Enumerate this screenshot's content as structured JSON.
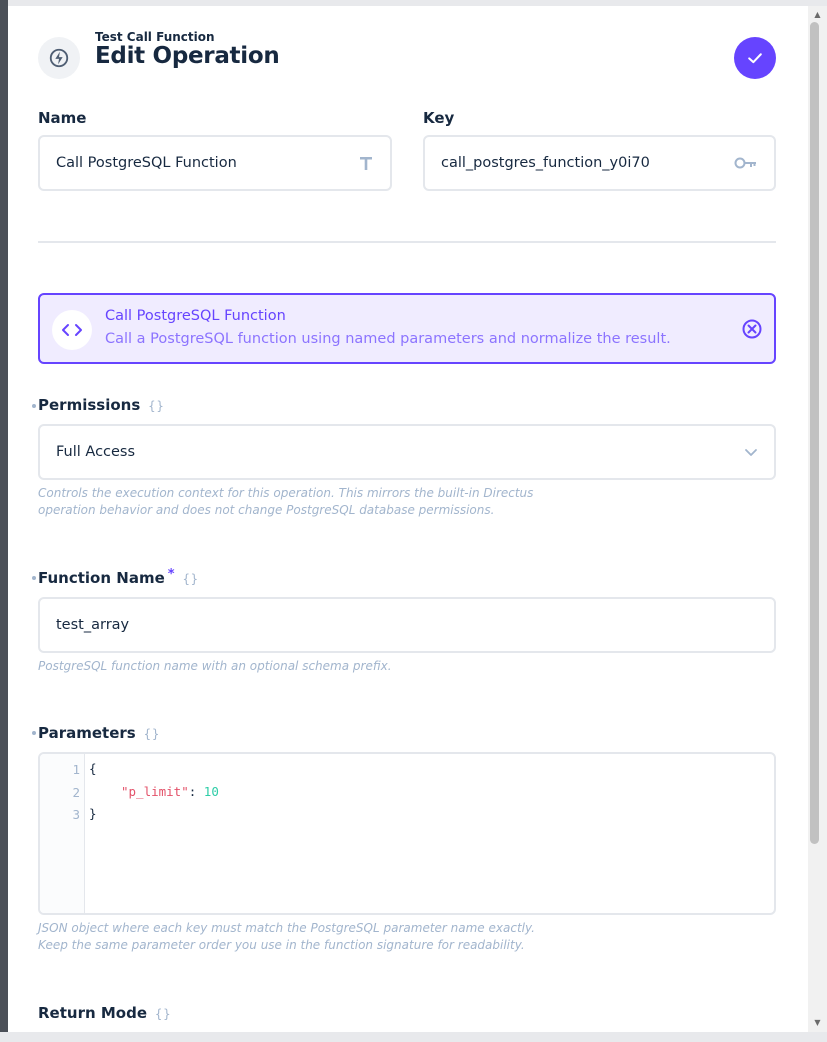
{
  "header": {
    "subtitle": "Test Call Function",
    "title": "Edit Operation",
    "icon": "bolt-icon"
  },
  "fields": {
    "name": {
      "label": "Name",
      "value": "Call PostgreSQL Function",
      "icon": "text-type-icon"
    },
    "key": {
      "label": "Key",
      "value": "call_postgres_function_y0i70",
      "icon": "key-icon"
    }
  },
  "operation": {
    "title": "Call PostgreSQL Function",
    "description": "Call a PostgreSQL function using named parameters and normalize the result.",
    "icon": "code-icon"
  },
  "permissions": {
    "label": "Permissions",
    "value": "Full Access",
    "hint_lines": [
      "Controls the execution context for this operation. This mirrors the built-in Directus",
      "operation behavior and does not change PostgreSQL database permissions."
    ]
  },
  "function_name": {
    "label": "Function Name",
    "required_mark": "*",
    "value": "test_array",
    "hint": "PostgreSQL function name with an optional schema prefix."
  },
  "parameters": {
    "label": "Parameters",
    "code": {
      "line_numbers": [
        "1",
        "2",
        "3"
      ],
      "open_brace": "{",
      "key": "\"p_limit\"",
      "colon": ": ",
      "number": "10",
      "close_brace": "}"
    },
    "hint_lines": [
      "JSON object where each key must match the PostgreSQL parameter name exactly.",
      "Keep the same parameter order you use in the function signature for readability."
    ]
  },
  "return_mode": {
    "label": "Return Mode"
  },
  "json_badge": "{}",
  "colors": {
    "accent": "#6644ff",
    "accent_bg": "#f0ecff",
    "text": "#172940",
    "muted": "#a2b5cd",
    "border": "#e4e7ec",
    "code_key": "#e35169",
    "code_number": "#2ecda7"
  }
}
